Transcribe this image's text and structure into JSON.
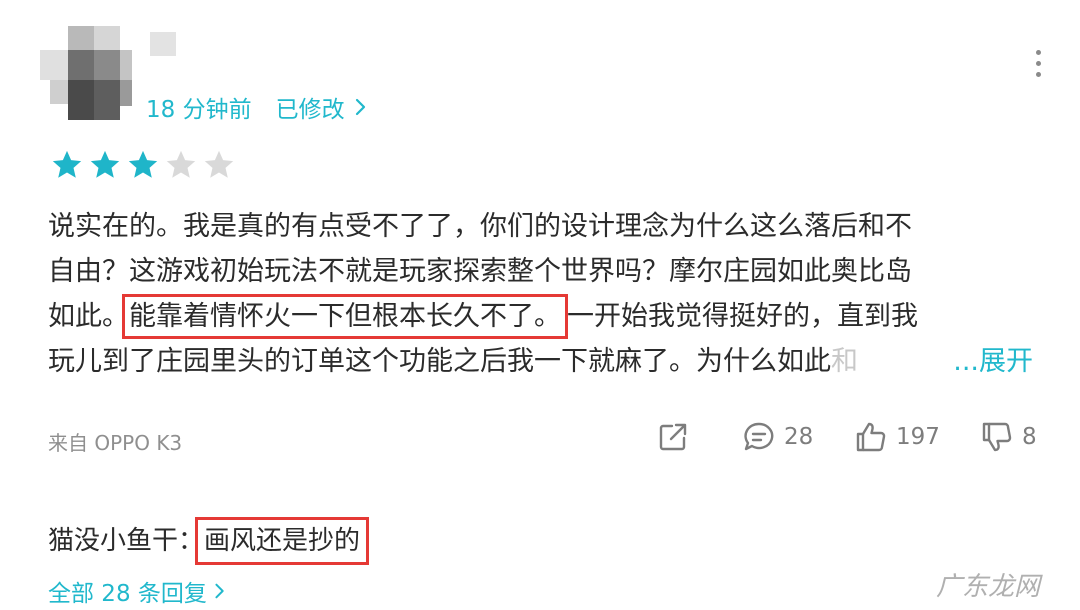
{
  "comment": {
    "time": "18 分钟前",
    "edited_label": "已修改",
    "rating": 3,
    "rating_max": 5,
    "body": {
      "line1": "说实在的。我是真的有点受不了了，你们的设计理念为什么这么落后和不",
      "line2": "自由？这游戏初始玩法不就是玩家探索整个世界吗？摩尔庄园如此奥比岛",
      "line3_pre": "如此。",
      "line3_highlight": "能靠着情怀火一下但根本长久不了。",
      "line3_post": "一开始我觉得挺好的，直到我",
      "line4": "玩儿到了庄园里头的订单这个功能之后我一下就麻了。为什么如此",
      "line4_fade": "和",
      "expand_label": "...展开"
    },
    "device": "来自 OPPO K3",
    "reply_count": "28",
    "like_count": "197",
    "dislike_count": "8"
  },
  "reply": {
    "author": "猫没小鱼干：",
    "text": "画风还是抄的"
  },
  "all_replies_label": "全部 28 条回复",
  "watermark": "广东龙网",
  "colors": {
    "accent": "#21b8cc",
    "star_filled": "#1fb5c9",
    "star_empty": "#d9d9d9",
    "highlight_box": "#e53935"
  },
  "icons": [
    "more-icon",
    "chevron-right-icon",
    "star-icon",
    "share-icon",
    "comment-icon",
    "like-icon",
    "dislike-icon"
  ]
}
